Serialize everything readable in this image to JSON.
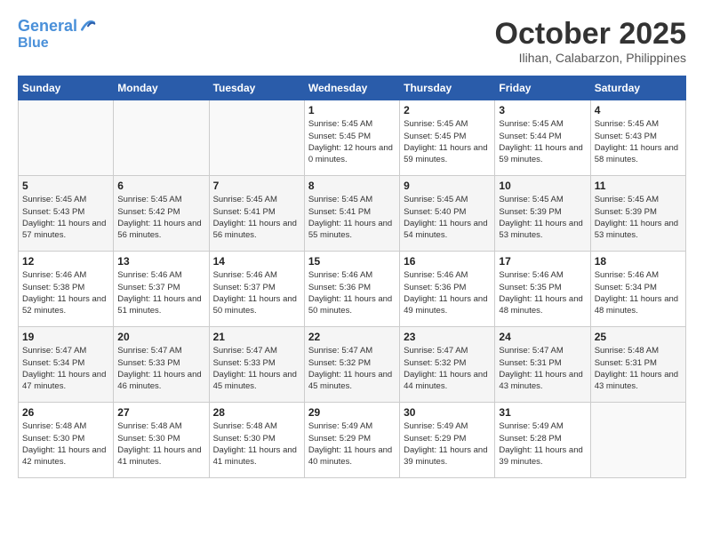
{
  "header": {
    "logo_line1": "General",
    "logo_line2": "Blue",
    "month": "October 2025",
    "location": "Ilihan, Calabarzon, Philippines"
  },
  "weekdays": [
    "Sunday",
    "Monday",
    "Tuesday",
    "Wednesday",
    "Thursday",
    "Friday",
    "Saturday"
  ],
  "weeks": [
    [
      {
        "day": "",
        "sunrise": "",
        "sunset": "",
        "daylight": ""
      },
      {
        "day": "",
        "sunrise": "",
        "sunset": "",
        "daylight": ""
      },
      {
        "day": "",
        "sunrise": "",
        "sunset": "",
        "daylight": ""
      },
      {
        "day": "1",
        "sunrise": "Sunrise: 5:45 AM",
        "sunset": "Sunset: 5:45 PM",
        "daylight": "Daylight: 12 hours and 0 minutes."
      },
      {
        "day": "2",
        "sunrise": "Sunrise: 5:45 AM",
        "sunset": "Sunset: 5:45 PM",
        "daylight": "Daylight: 11 hours and 59 minutes."
      },
      {
        "day": "3",
        "sunrise": "Sunrise: 5:45 AM",
        "sunset": "Sunset: 5:44 PM",
        "daylight": "Daylight: 11 hours and 59 minutes."
      },
      {
        "day": "4",
        "sunrise": "Sunrise: 5:45 AM",
        "sunset": "Sunset: 5:43 PM",
        "daylight": "Daylight: 11 hours and 58 minutes."
      }
    ],
    [
      {
        "day": "5",
        "sunrise": "Sunrise: 5:45 AM",
        "sunset": "Sunset: 5:43 PM",
        "daylight": "Daylight: 11 hours and 57 minutes."
      },
      {
        "day": "6",
        "sunrise": "Sunrise: 5:45 AM",
        "sunset": "Sunset: 5:42 PM",
        "daylight": "Daylight: 11 hours and 56 minutes."
      },
      {
        "day": "7",
        "sunrise": "Sunrise: 5:45 AM",
        "sunset": "Sunset: 5:41 PM",
        "daylight": "Daylight: 11 hours and 56 minutes."
      },
      {
        "day": "8",
        "sunrise": "Sunrise: 5:45 AM",
        "sunset": "Sunset: 5:41 PM",
        "daylight": "Daylight: 11 hours and 55 minutes."
      },
      {
        "day": "9",
        "sunrise": "Sunrise: 5:45 AM",
        "sunset": "Sunset: 5:40 PM",
        "daylight": "Daylight: 11 hours and 54 minutes."
      },
      {
        "day": "10",
        "sunrise": "Sunrise: 5:45 AM",
        "sunset": "Sunset: 5:39 PM",
        "daylight": "Daylight: 11 hours and 53 minutes."
      },
      {
        "day": "11",
        "sunrise": "Sunrise: 5:45 AM",
        "sunset": "Sunset: 5:39 PM",
        "daylight": "Daylight: 11 hours and 53 minutes."
      }
    ],
    [
      {
        "day": "12",
        "sunrise": "Sunrise: 5:46 AM",
        "sunset": "Sunset: 5:38 PM",
        "daylight": "Daylight: 11 hours and 52 minutes."
      },
      {
        "day": "13",
        "sunrise": "Sunrise: 5:46 AM",
        "sunset": "Sunset: 5:37 PM",
        "daylight": "Daylight: 11 hours and 51 minutes."
      },
      {
        "day": "14",
        "sunrise": "Sunrise: 5:46 AM",
        "sunset": "Sunset: 5:37 PM",
        "daylight": "Daylight: 11 hours and 50 minutes."
      },
      {
        "day": "15",
        "sunrise": "Sunrise: 5:46 AM",
        "sunset": "Sunset: 5:36 PM",
        "daylight": "Daylight: 11 hours and 50 minutes."
      },
      {
        "day": "16",
        "sunrise": "Sunrise: 5:46 AM",
        "sunset": "Sunset: 5:36 PM",
        "daylight": "Daylight: 11 hours and 49 minutes."
      },
      {
        "day": "17",
        "sunrise": "Sunrise: 5:46 AM",
        "sunset": "Sunset: 5:35 PM",
        "daylight": "Daylight: 11 hours and 48 minutes."
      },
      {
        "day": "18",
        "sunrise": "Sunrise: 5:46 AM",
        "sunset": "Sunset: 5:34 PM",
        "daylight": "Daylight: 11 hours and 48 minutes."
      }
    ],
    [
      {
        "day": "19",
        "sunrise": "Sunrise: 5:47 AM",
        "sunset": "Sunset: 5:34 PM",
        "daylight": "Daylight: 11 hours and 47 minutes."
      },
      {
        "day": "20",
        "sunrise": "Sunrise: 5:47 AM",
        "sunset": "Sunset: 5:33 PM",
        "daylight": "Daylight: 11 hours and 46 minutes."
      },
      {
        "day": "21",
        "sunrise": "Sunrise: 5:47 AM",
        "sunset": "Sunset: 5:33 PM",
        "daylight": "Daylight: 11 hours and 45 minutes."
      },
      {
        "day": "22",
        "sunrise": "Sunrise: 5:47 AM",
        "sunset": "Sunset: 5:32 PM",
        "daylight": "Daylight: 11 hours and 45 minutes."
      },
      {
        "day": "23",
        "sunrise": "Sunrise: 5:47 AM",
        "sunset": "Sunset: 5:32 PM",
        "daylight": "Daylight: 11 hours and 44 minutes."
      },
      {
        "day": "24",
        "sunrise": "Sunrise: 5:47 AM",
        "sunset": "Sunset: 5:31 PM",
        "daylight": "Daylight: 11 hours and 43 minutes."
      },
      {
        "day": "25",
        "sunrise": "Sunrise: 5:48 AM",
        "sunset": "Sunset: 5:31 PM",
        "daylight": "Daylight: 11 hours and 43 minutes."
      }
    ],
    [
      {
        "day": "26",
        "sunrise": "Sunrise: 5:48 AM",
        "sunset": "Sunset: 5:30 PM",
        "daylight": "Daylight: 11 hours and 42 minutes."
      },
      {
        "day": "27",
        "sunrise": "Sunrise: 5:48 AM",
        "sunset": "Sunset: 5:30 PM",
        "daylight": "Daylight: 11 hours and 41 minutes."
      },
      {
        "day": "28",
        "sunrise": "Sunrise: 5:48 AM",
        "sunset": "Sunset: 5:30 PM",
        "daylight": "Daylight: 11 hours and 41 minutes."
      },
      {
        "day": "29",
        "sunrise": "Sunrise: 5:49 AM",
        "sunset": "Sunset: 5:29 PM",
        "daylight": "Daylight: 11 hours and 40 minutes."
      },
      {
        "day": "30",
        "sunrise": "Sunrise: 5:49 AM",
        "sunset": "Sunset: 5:29 PM",
        "daylight": "Daylight: 11 hours and 39 minutes."
      },
      {
        "day": "31",
        "sunrise": "Sunrise: 5:49 AM",
        "sunset": "Sunset: 5:28 PM",
        "daylight": "Daylight: 11 hours and 39 minutes."
      },
      {
        "day": "",
        "sunrise": "",
        "sunset": "",
        "daylight": ""
      }
    ]
  ]
}
